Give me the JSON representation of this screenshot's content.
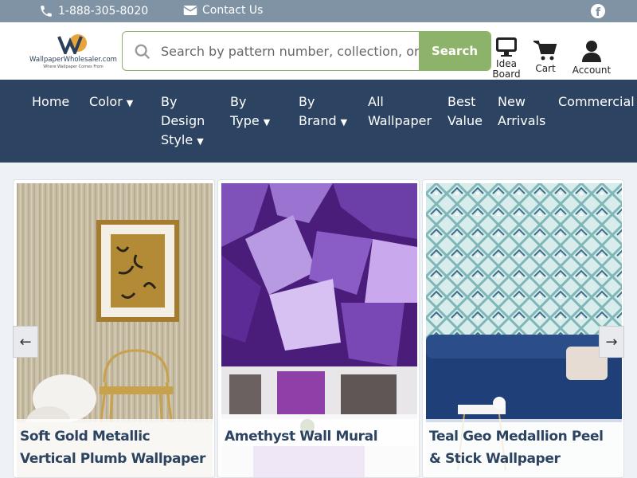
{
  "topbar": {
    "phone": "1-888-305-8020",
    "contact": "Contact Us",
    "social_icon": "facebook-icon"
  },
  "header": {
    "logo_text": "WallpaperWholesaler.com",
    "logo_tagline": "Where Wallpaper Comes From",
    "search_placeholder": "Search by pattern number, collection, or keyword",
    "search_button": "Search",
    "idea_board_line1": "Idea",
    "idea_board_line2": "Board",
    "cart": "Cart",
    "account": "Account"
  },
  "nav": {
    "items": [
      {
        "line1": "Home"
      },
      {
        "line1": "Color",
        "caret": true
      },
      {
        "line1": "By",
        "line2": "Design",
        "line3": "Style",
        "caret": true
      },
      {
        "line1": "By",
        "line2": "Type",
        "caret": true
      },
      {
        "line1": "By",
        "line2": "Brand",
        "caret": true
      },
      {
        "line1": "All",
        "line2": "Wallpaper"
      },
      {
        "line1": "Best",
        "line2": "Value"
      },
      {
        "line1": "New",
        "line2": "Arrivals"
      },
      {
        "line1": "Commercial"
      }
    ]
  },
  "slider": {
    "prev": "←",
    "next": "→",
    "products": [
      {
        "title": "Soft Gold Metallic Vertical Plumb Wallpaper"
      },
      {
        "title": "Amethyst Wall Mural"
      },
      {
        "title": "Teal Geo Medallion Peel & Stick Wallpaper"
      }
    ]
  },
  "colors": {
    "topbar": "#7f93a5",
    "nav": "#2c4361",
    "accent": "#8db36a"
  }
}
